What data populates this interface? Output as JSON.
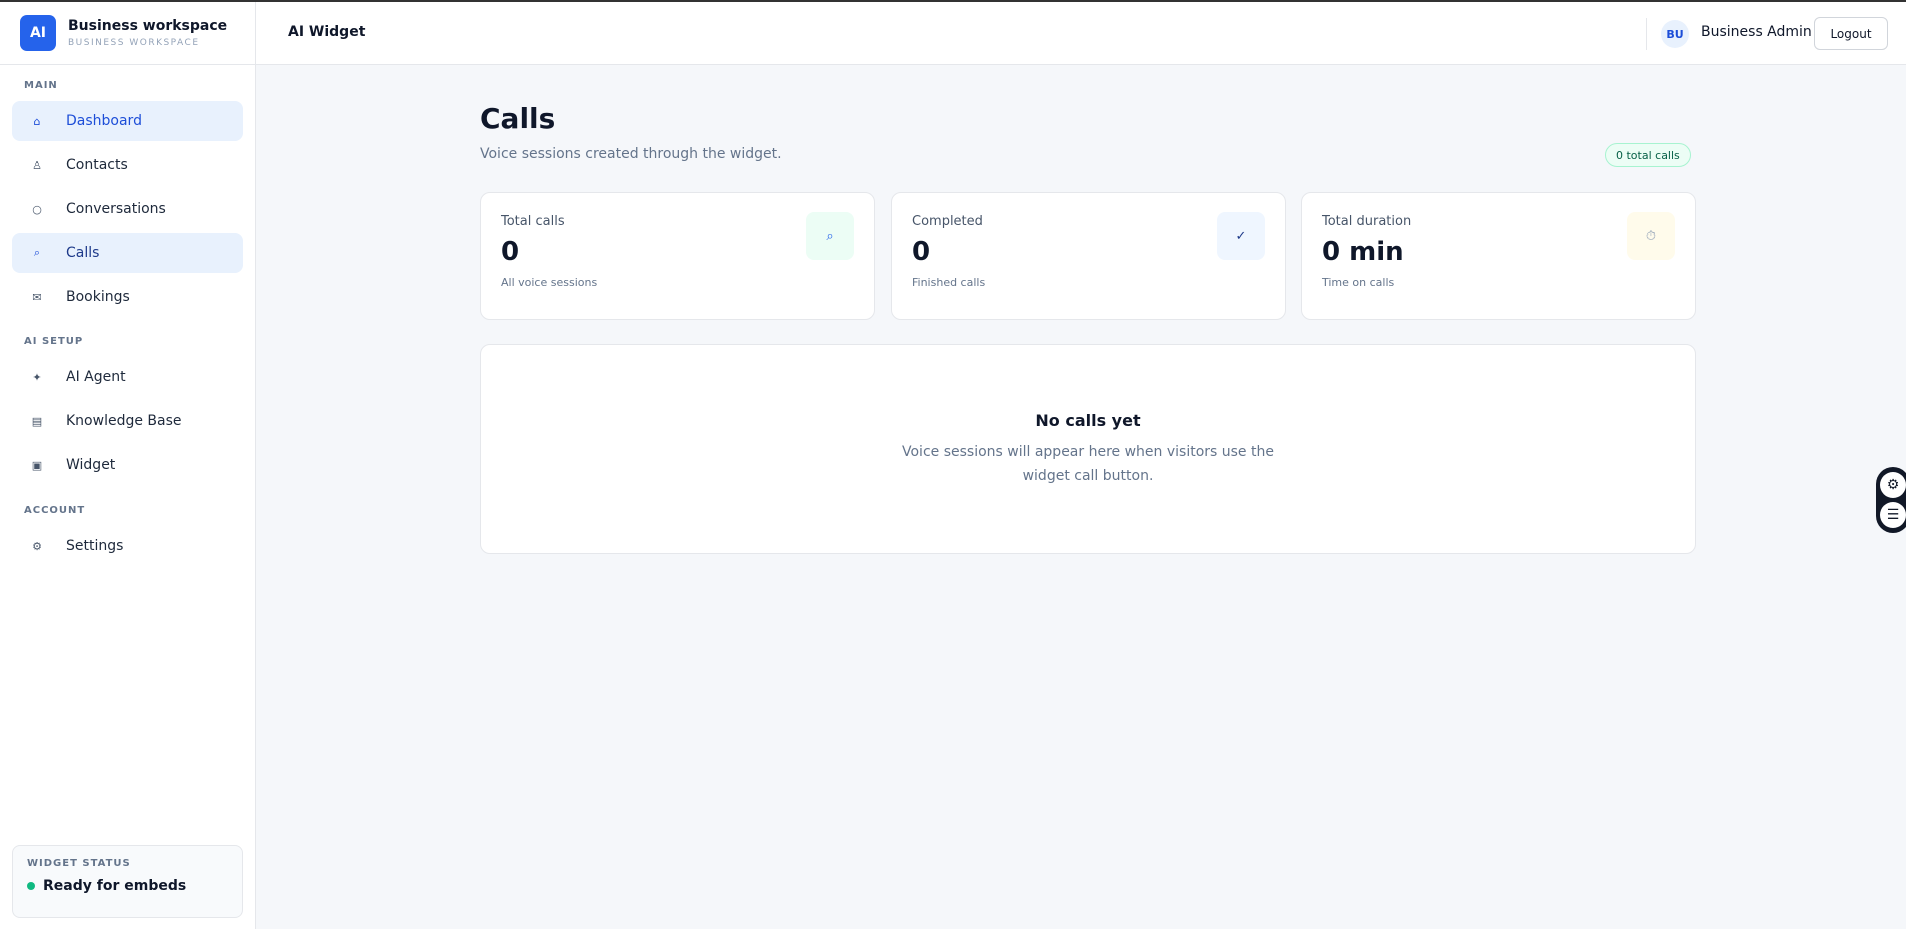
{
  "brand": {
    "logo": "AI",
    "name": "Business workspace",
    "sub": "BUSINESS WORKSPACE"
  },
  "sidebar": {
    "sections": [
      {
        "label": "MAIN"
      },
      {
        "label": "AI SETUP"
      },
      {
        "label": "ACCOUNT"
      }
    ],
    "items": [
      {
        "label": "Dashboard",
        "icon": "⌂",
        "icon_name": "home-icon"
      },
      {
        "label": "Contacts",
        "icon": "♙",
        "icon_name": "user-icon"
      },
      {
        "label": "Conversations",
        "icon": "○",
        "icon_name": "chat-icon"
      },
      {
        "label": "Calls",
        "icon": "⌕",
        "icon_name": "phone-icon"
      },
      {
        "label": "Bookings",
        "icon": "✉",
        "icon_name": "calendar-icon"
      },
      {
        "label": "AI Agent",
        "icon": "✦",
        "icon_name": "sparkle-icon"
      },
      {
        "label": "Knowledge Base",
        "icon": "▤",
        "icon_name": "book-icon"
      },
      {
        "label": "Widget",
        "icon": "▣",
        "icon_name": "widget-icon"
      },
      {
        "label": "Settings",
        "icon": "⚙",
        "icon_name": "gear-icon"
      }
    ],
    "status": {
      "label": "WIDGET STATUS",
      "text": "Ready for embeds"
    }
  },
  "header": {
    "title": "AI Widget",
    "avatar": "BU",
    "user": "Business Admin",
    "logout": "Logout"
  },
  "page": {
    "title": "Calls",
    "subtitle": "Voice sessions created through the widget.",
    "badge": "0 total calls"
  },
  "stats": [
    {
      "label": "Total calls",
      "value": "0",
      "hint": "All voice sessions",
      "icon": "⌕",
      "icon_name": "phone-icon",
      "color": "#ecfdf5",
      "icon_color": "#2563eb"
    },
    {
      "label": "Completed",
      "value": "0",
      "hint": "Finished calls",
      "icon": "✓",
      "icon_name": "check-icon",
      "color": "#eff6ff",
      "icon_color": "#1e3a8a"
    },
    {
      "label": "Total duration",
      "value": "0 min",
      "hint": "Time on calls",
      "icon": "⏱",
      "icon_name": "timer-icon",
      "color": "#fffbeb",
      "icon_color": "#94a3b8"
    }
  ],
  "empty": {
    "title": "No calls yet",
    "desc": "Voice sessions will appear here when visitors use the widget call button."
  },
  "float": {
    "icons": [
      "⚙",
      "☰"
    ]
  },
  "colors": {
    "accent": "#2563eb",
    "active_bg": "#e8f1fd",
    "success": "#10b981"
  }
}
